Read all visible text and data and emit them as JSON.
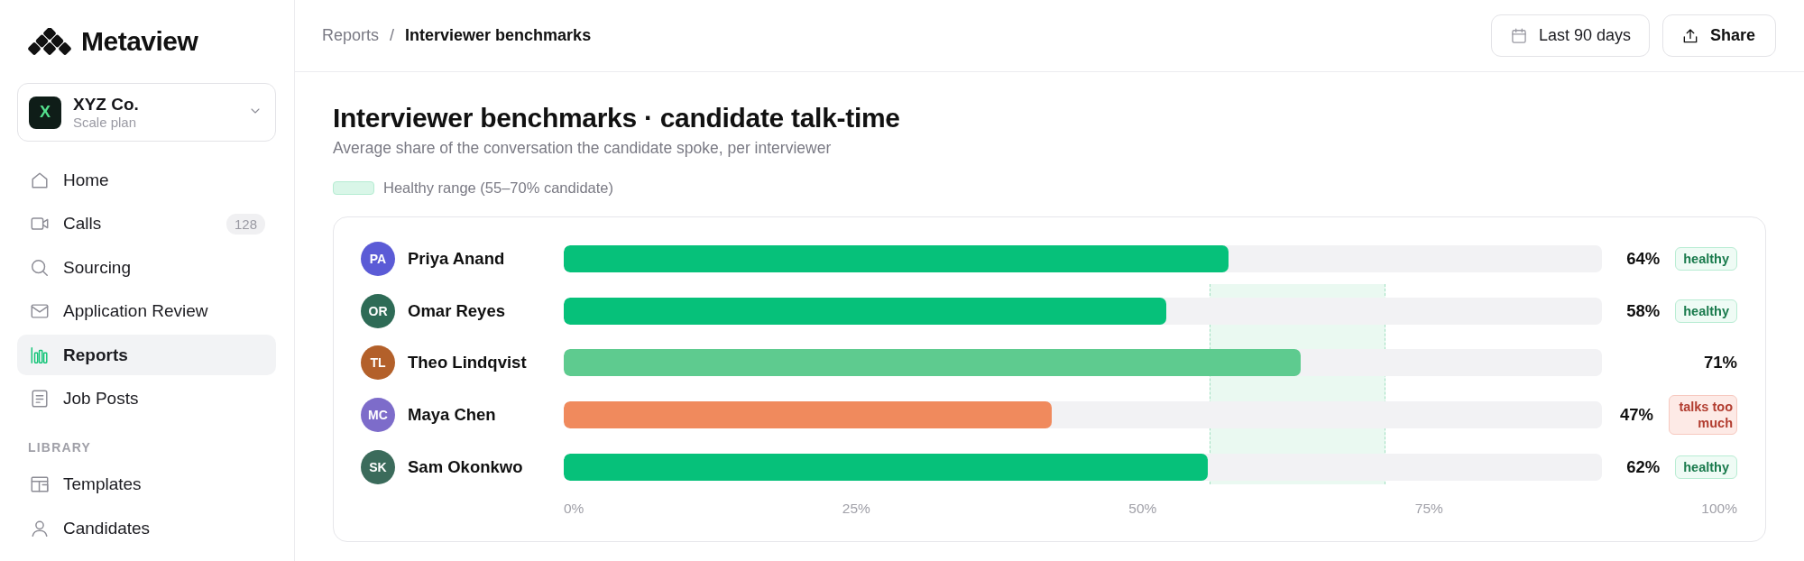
{
  "sidebar": {
    "brand": "Metaview",
    "workspace": {
      "initial": "X",
      "name": "XYZ Co.",
      "plan": "Scale plan"
    },
    "nav": [
      {
        "label": "Home",
        "selected": false
      },
      {
        "label": "Calls",
        "count": "128",
        "selected": false
      },
      {
        "label": "Sourcing",
        "selected": false
      },
      {
        "label": "Application Review",
        "selected": false
      },
      {
        "label": "Reports",
        "selected": true
      },
      {
        "label": "Job Posts",
        "selected": false
      }
    ],
    "library": {
      "heading": "LIBRARY",
      "items": [
        {
          "label": "Templates",
          "selected": false
        },
        {
          "label": "Candidates",
          "selected": false
        }
      ]
    }
  },
  "header": {
    "breadcrumb": {
      "items": [
        "Reports",
        "Interviewer benchmarks"
      ],
      "separator": "/"
    },
    "actions": [
      {
        "kind": "date",
        "label": "Last 90 days"
      },
      {
        "kind": "share",
        "label": "Share"
      }
    ]
  },
  "report": {
    "title": "Interviewer benchmarks · candidate talk-time",
    "subtitle": "Average share of the conversation the candidate spoke, per interviewer",
    "legend": "Healthy range (55–70% candidate)",
    "rows": [
      {
        "initials": "PA",
        "name": "Priya Anand",
        "color": "#5b5bd6",
        "kind": "healthy",
        "level": 0.64,
        "reading": "64%",
        "badge": "healthy"
      },
      {
        "initials": "OR",
        "name": "Omar Reyes",
        "color": "#2e6b56",
        "kind": "healthy",
        "level": 0.58,
        "reading": "58%",
        "badge": "healthy"
      },
      {
        "initials": "TL",
        "name": "Theo Lindqvist",
        "color": "#b3602a",
        "kind": "high",
        "level": 0.71,
        "reading": "71%"
      },
      {
        "initials": "MC",
        "name": "Maya Chen",
        "color": "#7d6cca",
        "kind": "low",
        "level": 0.47,
        "reading": "47%",
        "badge": "talks too much"
      },
      {
        "initials": "SK",
        "name": "Sam Okonkwo",
        "color": "#3b6b5b",
        "kind": "healthy",
        "level": 0.62,
        "reading": "62%",
        "badge": "healthy"
      }
    ],
    "axis_ticks": [
      "0%",
      "25%",
      "50%",
      "75%",
      "100%"
    ]
  }
}
